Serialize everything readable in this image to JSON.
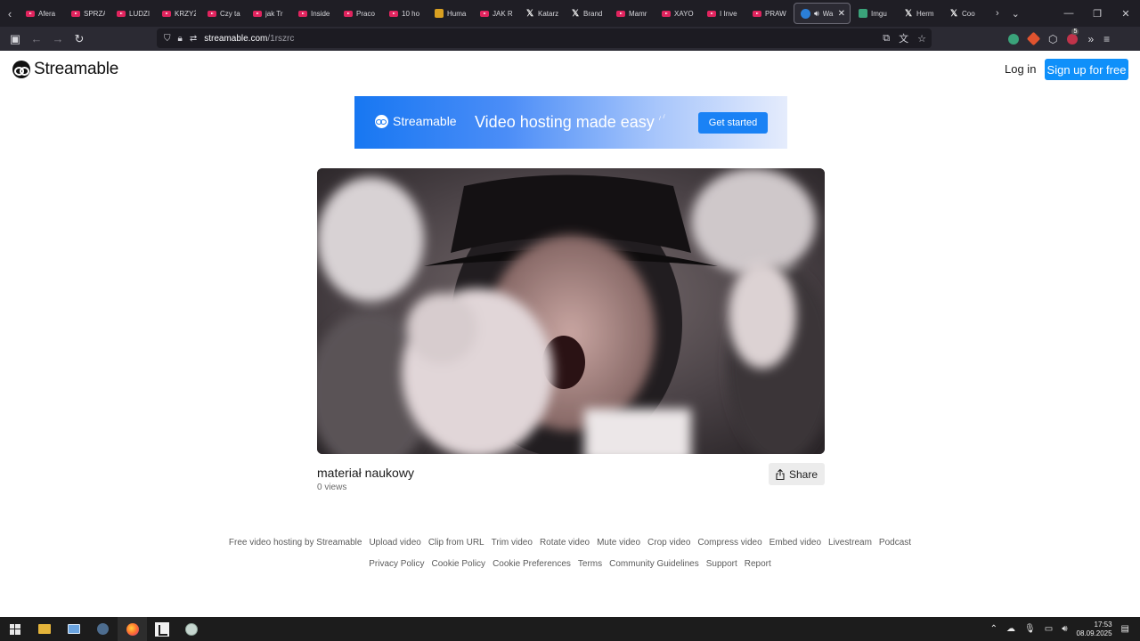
{
  "browser": {
    "tabs": [
      {
        "title": "Afera",
        "icon": "youtube-icon"
      },
      {
        "title": "SPRZA",
        "icon": "youtube-icon"
      },
      {
        "title": "LUDZI",
        "icon": "youtube-icon"
      },
      {
        "title": "KRZYŻ",
        "icon": "youtube-icon"
      },
      {
        "title": "Czy ta",
        "icon": "youtube-icon"
      },
      {
        "title": "jak Tr",
        "icon": "youtube-icon"
      },
      {
        "title": "Inside",
        "icon": "youtube-icon"
      },
      {
        "title": "Praco",
        "icon": "youtube-icon"
      },
      {
        "title": "10 ho",
        "icon": "youtube-icon"
      },
      {
        "title": "Huma",
        "icon": "humble-icon"
      },
      {
        "title": "JAK R",
        "icon": "youtube-icon"
      },
      {
        "title": "Katarz",
        "icon": "x-icon"
      },
      {
        "title": "Brand",
        "icon": "x-icon"
      },
      {
        "title": "Mamr",
        "icon": "youtube-icon"
      },
      {
        "title": "XAYO",
        "icon": "youtube-icon"
      },
      {
        "title": "I Inve",
        "icon": "youtube-icon"
      },
      {
        "title": "PRAW",
        "icon": "youtube-icon"
      },
      {
        "title": "Wa",
        "icon": "streamable-icon",
        "active": true
      },
      {
        "title": "Imgu",
        "icon": "imgur-icon"
      },
      {
        "title": "Herm",
        "icon": "x-icon"
      },
      {
        "title": "Coo",
        "icon": "x-icon"
      }
    ],
    "url_host": "streamable.com",
    "url_path": "/1rszrc"
  },
  "site": {
    "brand": "Streamable",
    "login_label": "Log in",
    "signup_label": "Sign up for free"
  },
  "banner": {
    "brand": "Streamable",
    "tagline": "Video hosting made easy",
    "cta": "Get started"
  },
  "video": {
    "title": "materiał naukowy",
    "views": "0 views",
    "share_label": "Share"
  },
  "footer": {
    "row1": [
      "Free video hosting by Streamable",
      "Upload video",
      "Clip from URL",
      "Trim video",
      "Rotate video",
      "Mute video",
      "Crop video",
      "Compress video",
      "Embed video",
      "Livestream",
      "Podcast"
    ],
    "row2": [
      "Privacy Policy",
      "Cookie Policy",
      "Cookie Preferences",
      "Terms",
      "Community Guidelines",
      "Support",
      "Report"
    ]
  },
  "taskbar": {
    "time": "17:53",
    "date": "08.09.2025"
  },
  "colors": {
    "accent": "#0f90fa",
    "tabstrip": "#1f1e25",
    "navbar": "#2b2a33"
  }
}
